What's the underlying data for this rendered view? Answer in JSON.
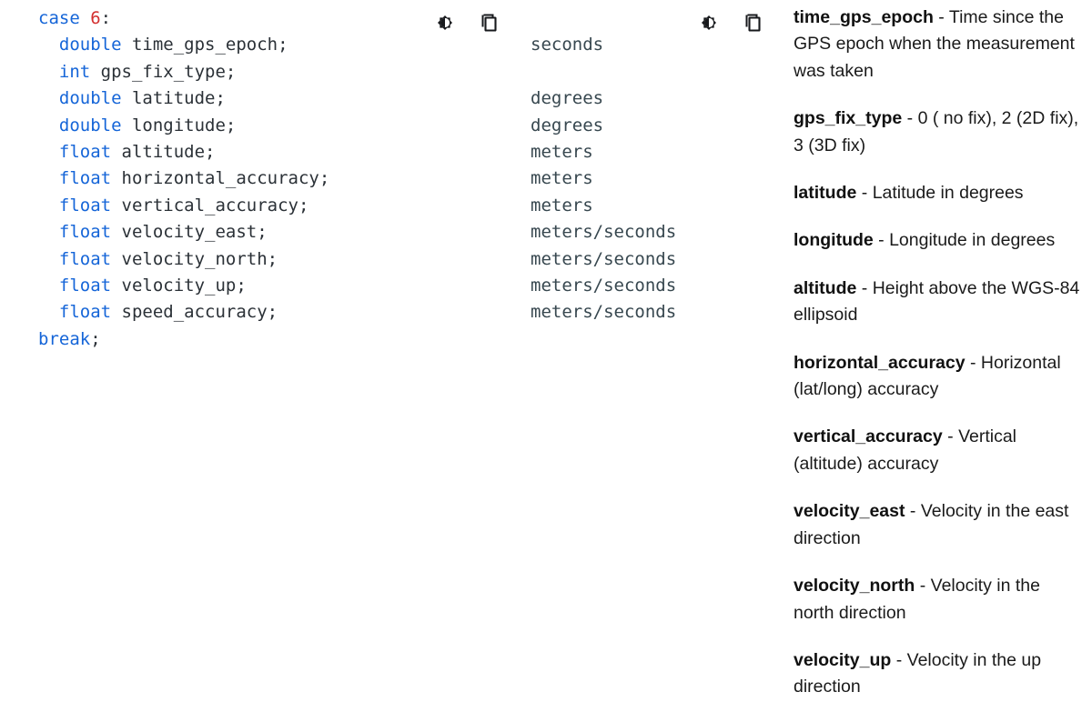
{
  "code": {
    "language": "c",
    "lines": [
      [
        {
          "t": "case",
          "c": "kw"
        },
        {
          "t": " ",
          "c": "punc"
        },
        {
          "t": "6",
          "c": "num"
        },
        {
          "t": ":",
          "c": "punc"
        }
      ],
      [
        {
          "t": "  ",
          "c": "punc"
        },
        {
          "t": "double",
          "c": "kw"
        },
        {
          "t": " time_gps_epoch;",
          "c": "id"
        }
      ],
      [
        {
          "t": "  ",
          "c": "punc"
        },
        {
          "t": "int",
          "c": "kw"
        },
        {
          "t": " gps_fix_type;",
          "c": "id"
        }
      ],
      [
        {
          "t": "  ",
          "c": "punc"
        },
        {
          "t": "double",
          "c": "kw"
        },
        {
          "t": " latitude;",
          "c": "id"
        }
      ],
      [
        {
          "t": "  ",
          "c": "punc"
        },
        {
          "t": "double",
          "c": "kw"
        },
        {
          "t": " longitude;",
          "c": "id"
        }
      ],
      [
        {
          "t": "  ",
          "c": "punc"
        },
        {
          "t": "float",
          "c": "kw"
        },
        {
          "t": " altitude;",
          "c": "id"
        }
      ],
      [
        {
          "t": "  ",
          "c": "punc"
        },
        {
          "t": "float",
          "c": "kw"
        },
        {
          "t": " horizontal_accuracy;",
          "c": "id"
        }
      ],
      [
        {
          "t": "  ",
          "c": "punc"
        },
        {
          "t": "float",
          "c": "kw"
        },
        {
          "t": " vertical_accuracy;",
          "c": "id"
        }
      ],
      [
        {
          "t": "  ",
          "c": "punc"
        },
        {
          "t": "float",
          "c": "kw"
        },
        {
          "t": " velocity_east;",
          "c": "id"
        }
      ],
      [
        {
          "t": "  ",
          "c": "punc"
        },
        {
          "t": "float",
          "c": "kw"
        },
        {
          "t": " velocity_north;",
          "c": "id"
        }
      ],
      [
        {
          "t": "  ",
          "c": "punc"
        },
        {
          "t": "float",
          "c": "kw"
        },
        {
          "t": " velocity_up;",
          "c": "id"
        }
      ],
      [
        {
          "t": "  ",
          "c": "punc"
        },
        {
          "t": "float",
          "c": "kw"
        },
        {
          "t": " speed_accuracy;",
          "c": "id"
        }
      ],
      [
        {
          "t": "break",
          "c": "kw"
        },
        {
          "t": ";",
          "c": "punc"
        }
      ]
    ]
  },
  "toolbars": [
    {
      "id": "code-toolbar",
      "buttons": [
        {
          "icon": "brightness-contrast-icon",
          "label": "Toggle theme"
        },
        {
          "icon": "copy-icon",
          "label": "Copy"
        }
      ]
    },
    {
      "id": "units-toolbar",
      "buttons": [
        {
          "icon": "brightness-contrast-icon",
          "label": "Toggle theme"
        },
        {
          "icon": "copy-icon",
          "label": "Copy"
        }
      ]
    }
  ],
  "units": [
    "",
    "seconds",
    "",
    "degrees",
    "degrees",
    "meters",
    "meters",
    "meters",
    "meters/seconds",
    "meters/seconds",
    "meters/seconds",
    "meters/seconds",
    ""
  ],
  "descriptions": [
    {
      "name": "time_gps_epoch",
      "sep": " - ",
      "text": "Time since the GPS epoch when the measurement was taken"
    },
    {
      "name": "gps_fix_type",
      "sep": " - ",
      "text": "0 ( no fix), 2 (2D fix), 3 (3D fix)"
    },
    {
      "name": "latitude",
      "sep": " - ",
      "text": "Latitude in degrees"
    },
    {
      "name": "longitude",
      "sep": " - ",
      "text": "Longitude in degrees"
    },
    {
      "name": "altitude",
      "sep": " - ",
      "text": "Height above the WGS-84 ellipsoid"
    },
    {
      "name": "horizontal_accuracy",
      "sep": " - ",
      "text": "Horizontal (lat/long) accuracy"
    },
    {
      "name": "vertical_accuracy",
      "sep": " - ",
      "text": "Vertical (altitude) accuracy"
    },
    {
      "name": "velocity_east",
      "sep": " - ",
      "text": "Velocity in the east direction"
    },
    {
      "name": "velocity_north",
      "sep": " - ",
      "text": "Velocity in the north direction"
    },
    {
      "name": "velocity_up",
      "sep": " - ",
      "text": "Velocity in the up direction"
    }
  ],
  "colors": {
    "background": "#ffffff",
    "keyword": "#1565d8",
    "number": "#d32f2f",
    "identifier": "#2b3137",
    "unit_text": "#37474f",
    "description_text": "#1a1a1a",
    "icon": "#17191c"
  }
}
